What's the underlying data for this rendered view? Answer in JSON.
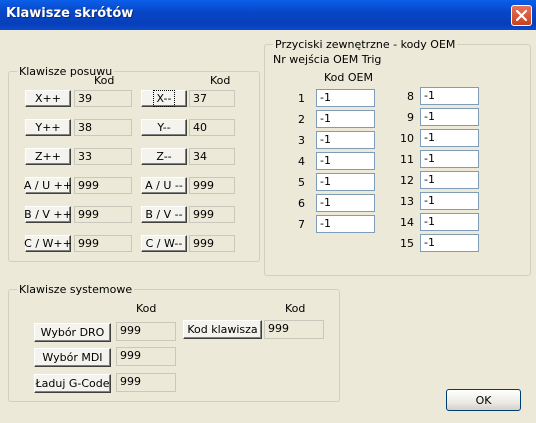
{
  "window": {
    "title": "Klawisze skrótów",
    "close_label": "✕"
  },
  "jog": {
    "legend": "Klawisze posuwu",
    "col_header_left": "Kod",
    "col_header_right": "Kod",
    "rows": [
      {
        "left_label": "X++",
        "left_value": "39",
        "right_label": "X--",
        "right_value": "37"
      },
      {
        "left_label": "Y++",
        "left_value": "38",
        "right_label": "Y--",
        "right_value": "40"
      },
      {
        "left_label": "Z++",
        "left_value": "33",
        "right_label": "Z--",
        "right_value": "34"
      },
      {
        "left_label": "A / U ++",
        "left_value": "999",
        "right_label": "A / U --",
        "right_value": "999"
      },
      {
        "left_label": "B / V ++",
        "left_value": "999",
        "right_label": "B / V --",
        "right_value": "999"
      },
      {
        "left_label": "C / W++",
        "left_value": "999",
        "right_label": "C / W--",
        "right_value": "999"
      }
    ]
  },
  "oem": {
    "legend": "Przyciski zewnętrzne - kody OEM",
    "subtitle": "Nr wejścia OEM Trig",
    "col_header": "Kod OEM",
    "left": [
      {
        "num": "1",
        "value": "-1"
      },
      {
        "num": "2",
        "value": "-1"
      },
      {
        "num": "3",
        "value": "-1"
      },
      {
        "num": "4",
        "value": "-1"
      },
      {
        "num": "5",
        "value": "-1"
      },
      {
        "num": "6",
        "value": "-1"
      },
      {
        "num": "7",
        "value": "-1"
      }
    ],
    "right": [
      {
        "num": "8",
        "value": "-1"
      },
      {
        "num": "9",
        "value": "-1"
      },
      {
        "num": "10",
        "value": "-1"
      },
      {
        "num": "11",
        "value": "-1"
      },
      {
        "num": "12",
        "value": "-1"
      },
      {
        "num": "13",
        "value": "-1"
      },
      {
        "num": "14",
        "value": "-1"
      },
      {
        "num": "15",
        "value": "-1"
      }
    ]
  },
  "system": {
    "legend": "Klawisze systemowe",
    "col_header_left": "Kod",
    "col_header_right": "Kod",
    "dro_label": "Wybór DRO",
    "dro_value": "999",
    "mdi_label": "Wybór MDI",
    "mdi_value": "999",
    "gcode_label": "Ładuj G-Code",
    "gcode_value": "999",
    "key_label": "Kod klawisza",
    "key_value": "999"
  },
  "ok_label": "OK"
}
